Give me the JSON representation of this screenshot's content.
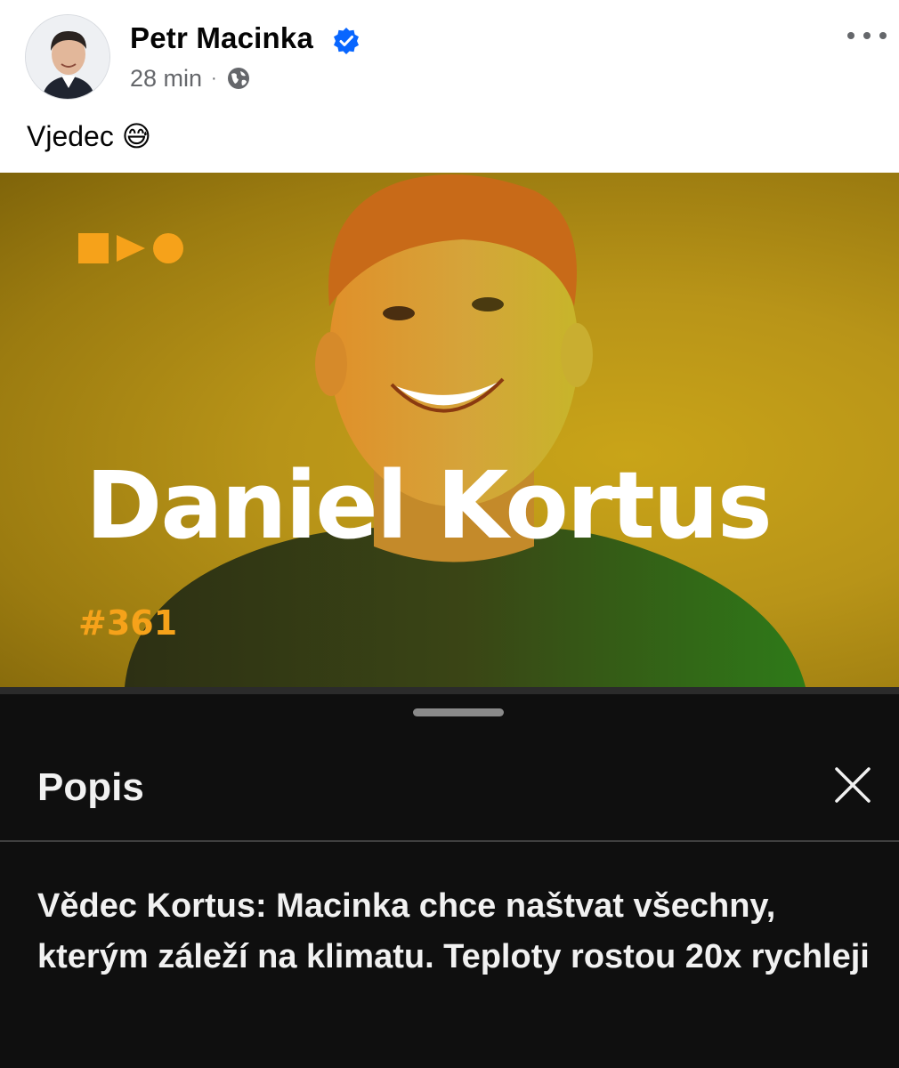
{
  "post": {
    "author_name": "Petr Macinka",
    "verified": true,
    "time": "28 min",
    "separator": "·",
    "privacy_icon": "globe-icon",
    "more_icon": "more-options-icon",
    "text": "Vjedec",
    "emoji": "😅"
  },
  "banner": {
    "name": "Daniel Kortus",
    "episode": "#361",
    "logo_icon": "square-play-circle-logo",
    "accent_color": "#f6a21a",
    "background_color": "#b89418"
  },
  "sheet": {
    "title": "Popis",
    "close_icon": "close-icon",
    "description": "Vědec Kortus: Macinka chce naštvat všechny, kterým záleží na klimatu. Teploty rostou 20x rychleji"
  },
  "colors": {
    "verified_blue": "#0866ff",
    "sheet_background": "#0f0f0f",
    "meta_gray": "#65676b"
  }
}
